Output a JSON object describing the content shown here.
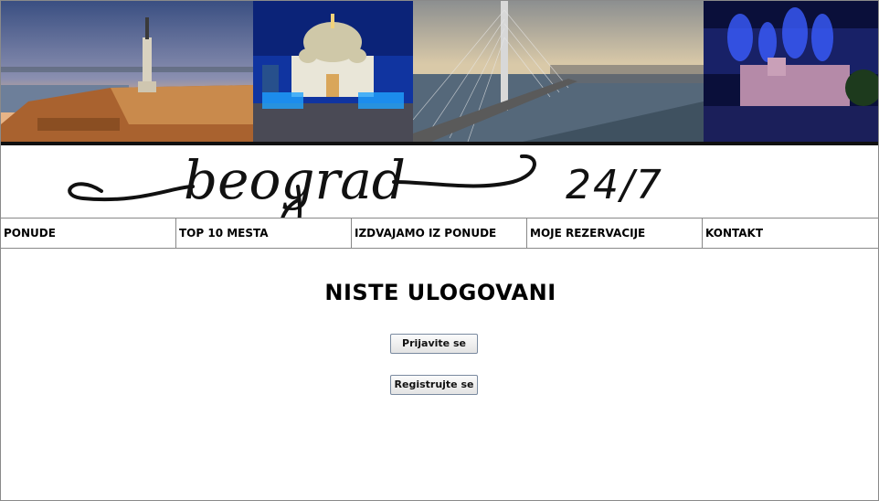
{
  "banner": {
    "photos": [
      {
        "name": "pobednik-monument-photo",
        "colors": {
          "sky_top": "#3a4f82",
          "sky_bottom": "#e7b487",
          "ground": "#b4703a"
        }
      },
      {
        "name": "st-sava-temple-photo",
        "colors": {
          "sky_top": "#0d2d8c",
          "sky_bottom": "#3061c4",
          "ground": "#4a4a55"
        }
      },
      {
        "name": "ada-bridge-photo",
        "colors": {
          "sky_top": "#b6b2a8",
          "sky_bottom": "#d9c9a8",
          "ground": "#3f5160"
        }
      },
      {
        "name": "fortress-fireworks-photo",
        "colors": {
          "sky_top": "#0a0f3a",
          "sky_bottom": "#2a2f8a",
          "ground": "#7a6a8a"
        }
      }
    ]
  },
  "logo": {
    "script_text": "beograd",
    "suffix": "24/7"
  },
  "nav": {
    "items": [
      {
        "label": "PONUDE"
      },
      {
        "label": "TOP 10 MESTA"
      },
      {
        "label": "IZDVAJAMO IZ PONUDE"
      },
      {
        "label": "MOJE REZERVACIJE"
      },
      {
        "label": "KONTAKT"
      }
    ]
  },
  "main": {
    "heading": "NISTE ULOGOVANI",
    "login_button": "Prijavite se",
    "register_button": "Registrujte se"
  }
}
